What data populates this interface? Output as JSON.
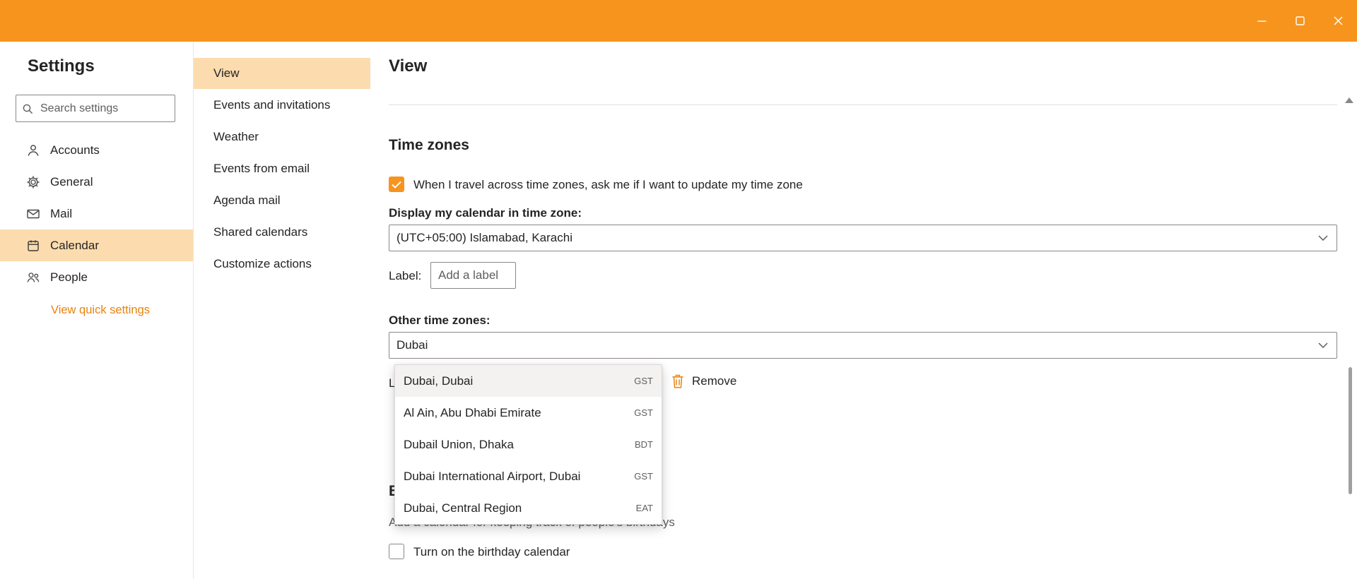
{
  "theme": {
    "accent": "#f7941e",
    "accent_light": "#fcdcae",
    "link_orange": "#e8830f",
    "text": "#252423",
    "text_secondary": "#605e5c"
  },
  "settings_panel": {
    "title": "Settings",
    "search": {
      "placeholder": "Search settings"
    },
    "items": [
      {
        "label": "Accounts",
        "icon": "person-icon",
        "selected": false
      },
      {
        "label": "General",
        "icon": "gear-icon",
        "selected": false
      },
      {
        "label": "Mail",
        "icon": "mail-icon",
        "selected": false
      },
      {
        "label": "Calendar",
        "icon": "calendar-icon",
        "selected": true
      },
      {
        "label": "People",
        "icon": "people-icon",
        "selected": false
      }
    ],
    "quick_settings_link": "View quick settings"
  },
  "section_nav": {
    "items": [
      {
        "label": "View",
        "selected": true
      },
      {
        "label": "Events and invitations",
        "selected": false
      },
      {
        "label": "Weather",
        "selected": false
      },
      {
        "label": "Events from email",
        "selected": false
      },
      {
        "label": "Agenda mail",
        "selected": false
      },
      {
        "label": "Shared calendars",
        "selected": false
      },
      {
        "label": "Customize actions",
        "selected": false
      }
    ]
  },
  "view_page": {
    "title": "View",
    "time_zones": {
      "heading": "Time zones",
      "travel_prompt": "When I travel across time zones, ask me if I want to update my time zone",
      "travel_checked": true,
      "display_label": "Display my calendar in time zone:",
      "display_value": "(UTC+05:00) Islamabad, Karachi",
      "label_caption": "Label:",
      "label_placeholder": "Add a label",
      "other_label": "Other time zones:",
      "other_query": "Dubai",
      "other_entry_caption": "Label:",
      "remove_label": "Remove",
      "suggestions": [
        {
          "place": "Dubai, Dubai",
          "abbr": "GST",
          "highlighted": true
        },
        {
          "place": "Al Ain, Abu Dhabi Emirate",
          "abbr": "GST",
          "highlighted": false
        },
        {
          "place": "Dubail Union, Dhaka",
          "abbr": "BDT",
          "highlighted": false
        },
        {
          "place": "Dubai International Airport, Dubai",
          "abbr": "GST",
          "highlighted": false
        },
        {
          "place": "Dubai, Central Region",
          "abbr": "EAT",
          "highlighted": false
        }
      ]
    },
    "birthday": {
      "heading": "B",
      "description": "Add a calendar for keeping track of people's birthdays",
      "toggle_label": "Turn on the birthday calendar",
      "toggle_checked": false
    }
  }
}
